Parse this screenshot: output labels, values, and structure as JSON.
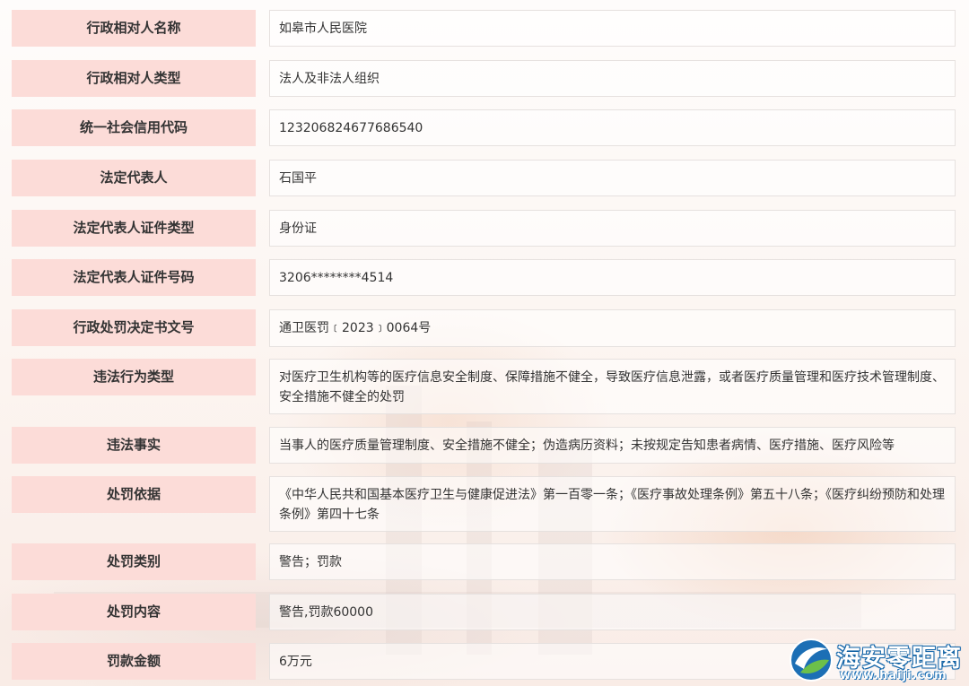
{
  "rows": [
    {
      "label": "行政相对人名称",
      "value": "如皋市人民医院"
    },
    {
      "label": "行政相对人类型",
      "value": "法人及非法人组织"
    },
    {
      "label": "统一社会信用代码",
      "value": "123206824677686540"
    },
    {
      "label": "法定代表人",
      "value": "石国平"
    },
    {
      "label": "法定代表人证件类型",
      "value": "身份证"
    },
    {
      "label": "法定代表人证件号码",
      "value": "3206********4514"
    },
    {
      "label": "行政处罚决定书文号",
      "value": "通卫医罚﹝2023﹞0064号"
    },
    {
      "label": "违法行为类型",
      "value": "对医疗卫生机构等的医疗信息安全制度、保障措施不健全，导致医疗信息泄露，或者医疗质量管理和医疗技术管理制度、安全措施不健全的处罚"
    },
    {
      "label": "违法事实",
      "value": "当事人的医疗质量管理制度、安全措施不健全；伪造病历资料；未按规定告知患者病情、医疗措施、医疗风险等"
    },
    {
      "label": "处罚依据",
      "value": "《中华人民共和国基本医疗卫生与健康促进法》第一百零一条；《医疗事故处理条例》第五十八条；《医疗纠纷预防和处理条例》第四十七条"
    },
    {
      "label": "处罚类别",
      "value": "警告；罚款"
    },
    {
      "label": "处罚内容",
      "value": "警告,罚款60000"
    },
    {
      "label": "罚款金额",
      "value": "6万元"
    }
  ],
  "watermark": {
    "name": "海安零距离",
    "url": "www.haiji.com",
    "icon": "globe-logo-icon"
  },
  "colors": {
    "label_bg": "#fcdcd8",
    "value_border": "#e6e1df",
    "text": "#333333",
    "watermark_blue": "#1c6fb5",
    "watermark_green": "#6cc04a"
  }
}
